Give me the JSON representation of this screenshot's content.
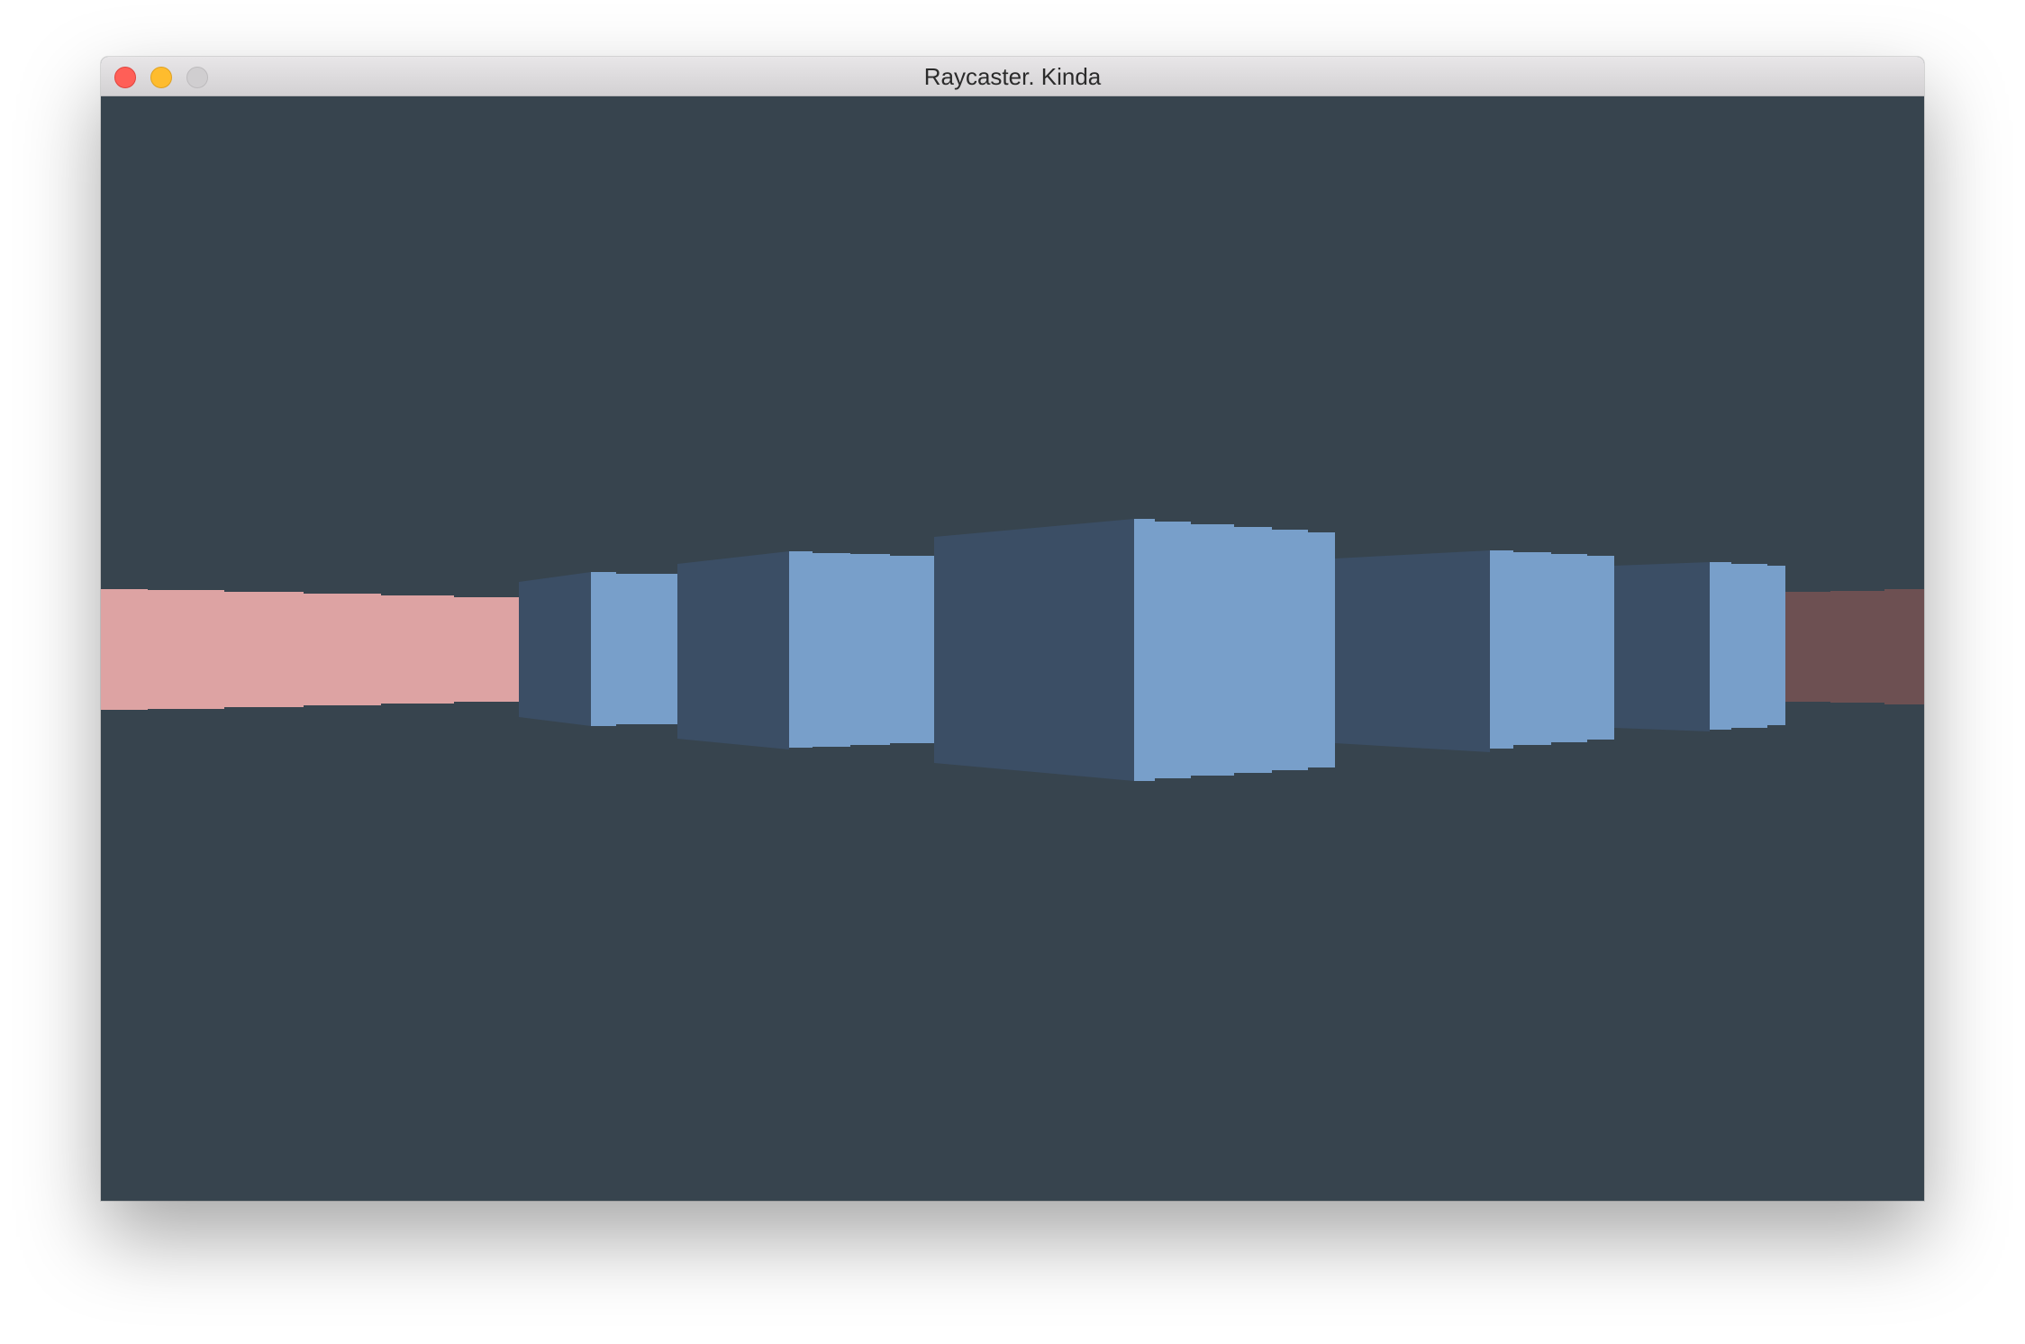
{
  "window": {
    "title": "Raycaster. Kinda",
    "controls": {
      "close_color": "#ff5f57",
      "minimize_color": "#febc2e",
      "zoom_color": "#d0ced0"
    }
  },
  "scene": {
    "background_color": "#37444e",
    "wall_colors": {
      "pink_wall": "#dda3a3",
      "dark_red_wall": "#6d5052",
      "blue_face_lit": "#789fca",
      "blue_face_shaded": "#3b4e65"
    }
  }
}
